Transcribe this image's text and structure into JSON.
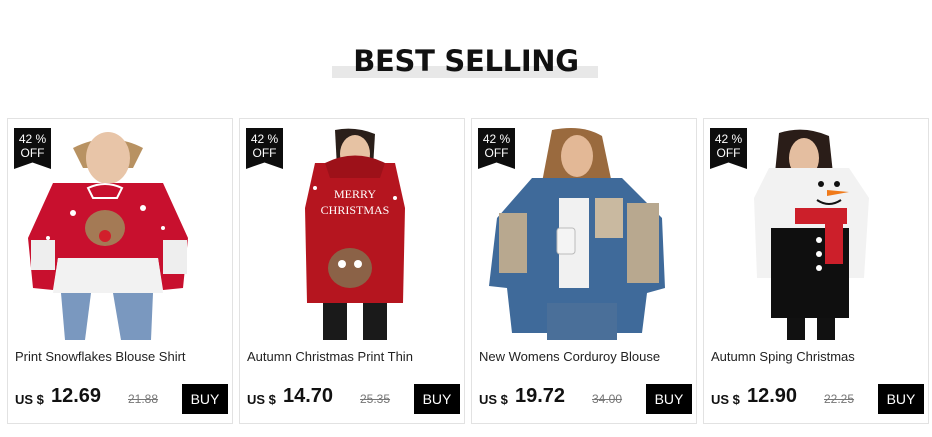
{
  "section": {
    "title": "BEST SELLING"
  },
  "products": [
    {
      "badge_pct": "42 %",
      "badge_off": "OFF",
      "name": "Print Snowflakes Blouse Shirt",
      "currency": "US $",
      "price": "12.69",
      "old_price": "21.88",
      "buy_label": "BUY"
    },
    {
      "badge_pct": "42 %",
      "badge_off": "OFF",
      "name": "Autumn Christmas Print Thin",
      "currency": "US $",
      "price": "14.70",
      "old_price": "25.35",
      "buy_label": "BUY",
      "image_text": [
        "MERRY",
        "CHRISTMAS"
      ]
    },
    {
      "badge_pct": "42 %",
      "badge_off": "OFF",
      "name": "New Womens Corduroy Blouse",
      "currency": "US $",
      "price": "19.72",
      "old_price": "34.00",
      "buy_label": "BUY"
    },
    {
      "badge_pct": "42 %",
      "badge_off": "OFF",
      "name": "Autumn Sping Christmas",
      "currency": "US $",
      "price": "12.90",
      "old_price": "22.25",
      "buy_label": "BUY"
    }
  ],
  "colors": {
    "badge": "#0d0d0d",
    "buy_button": "#000000",
    "title_underline": "#e8e8e8"
  }
}
